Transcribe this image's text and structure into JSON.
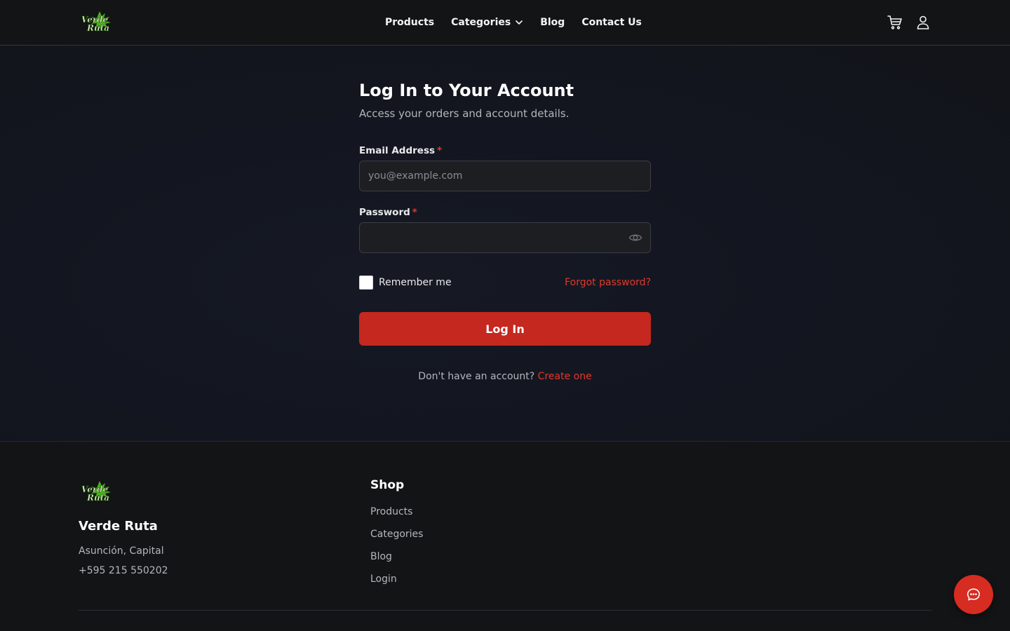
{
  "brand": {
    "logo_text_top": "Verde",
    "logo_text_bottom": "Ruta",
    "name": "Verde Ruta",
    "accent_color": "#c4281f",
    "logo_green": "#4caf1f"
  },
  "header": {
    "nav": [
      {
        "label": "Products"
      },
      {
        "label": "Categories",
        "has_dropdown": true
      },
      {
        "label": "Blog"
      },
      {
        "label": "Contact Us"
      }
    ],
    "icons": [
      "cart-icon",
      "user-icon",
      "chevron-down-icon"
    ]
  },
  "login": {
    "title": "Log In to Your Account",
    "subtitle": "Access your orders and account details.",
    "email_label": "Email Address",
    "email_placeholder": "you@example.com",
    "email_value": "",
    "password_label": "Password",
    "password_value": "",
    "required_mark": "*",
    "remember_label": "Remember me",
    "remember_checked": false,
    "forgot_label": "Forgot password?",
    "submit_label": "Log In",
    "signup_prompt": "Don't have an account?",
    "signup_link": "Create one"
  },
  "footer": {
    "address": "Asunción, Capital",
    "phone": "+595 215 550202",
    "shop_title": "Shop",
    "shop_links": [
      "Products",
      "Categories",
      "Blog",
      "Login"
    ]
  },
  "chat": {
    "icon": "chat-bubble-icon"
  }
}
